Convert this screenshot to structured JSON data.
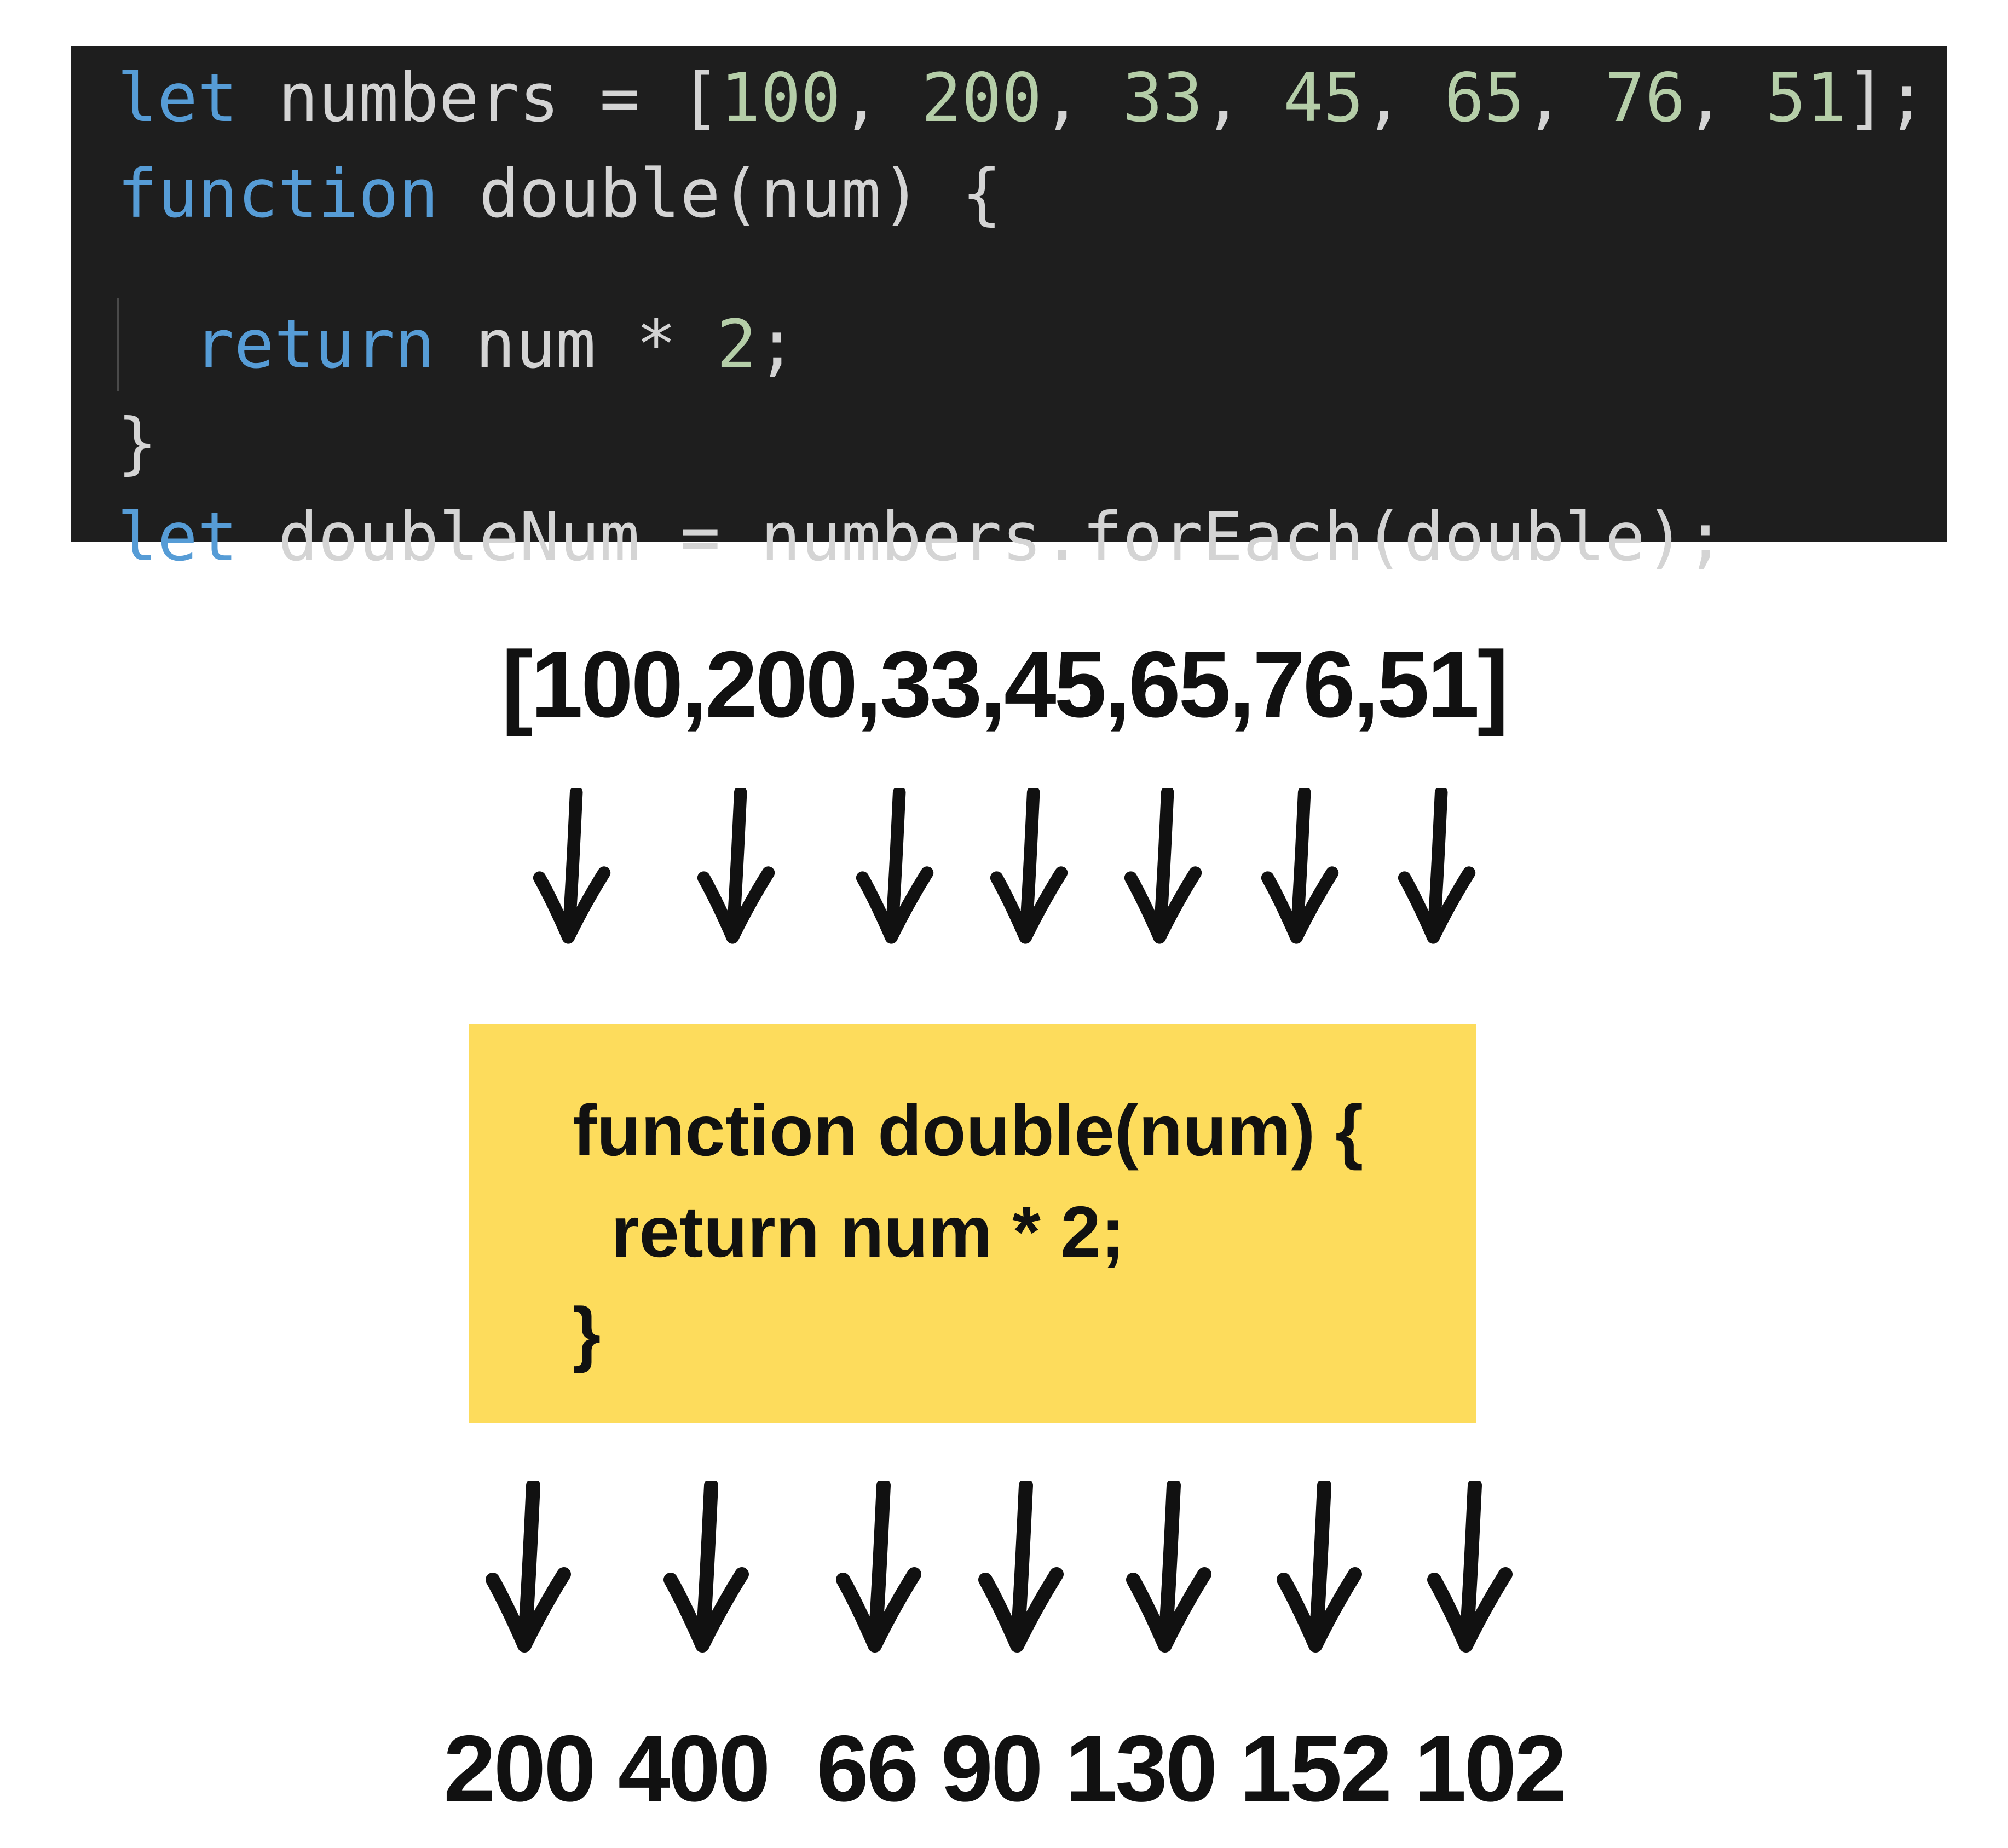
{
  "code_editor": {
    "line1": {
      "kw": "let",
      "name": "numbers",
      "eq": "=",
      "open": "[",
      "nums": [
        "100",
        "200",
        "33",
        "45",
        "65",
        "76",
        "51"
      ],
      "close": "];"
    },
    "line2": {
      "kw": "function",
      "rest": "double(num) {"
    },
    "line3": {
      "kw": "return",
      "expr": "num *",
      "num": "2",
      "end": ";"
    },
    "line4": {
      "text": "}"
    },
    "line5": {
      "kw": "let",
      "rest": "doubleNum = numbers.forEach(double);"
    }
  },
  "input_array": "[100,200,33,45,65,76,51]",
  "function_box": {
    "line1": "function double(num) {",
    "line2": "return num * 2;",
    "line3": "}",
    "background": "#fddc5c"
  },
  "output_values": "200 400  66 90 130 152 102",
  "arrow_icon": "down-arrow-icon",
  "colors": {
    "editor_bg": "#1e1e1e",
    "keyword": "#569cd6",
    "number": "#b5cea8",
    "identifier": "#d4d4d4"
  }
}
